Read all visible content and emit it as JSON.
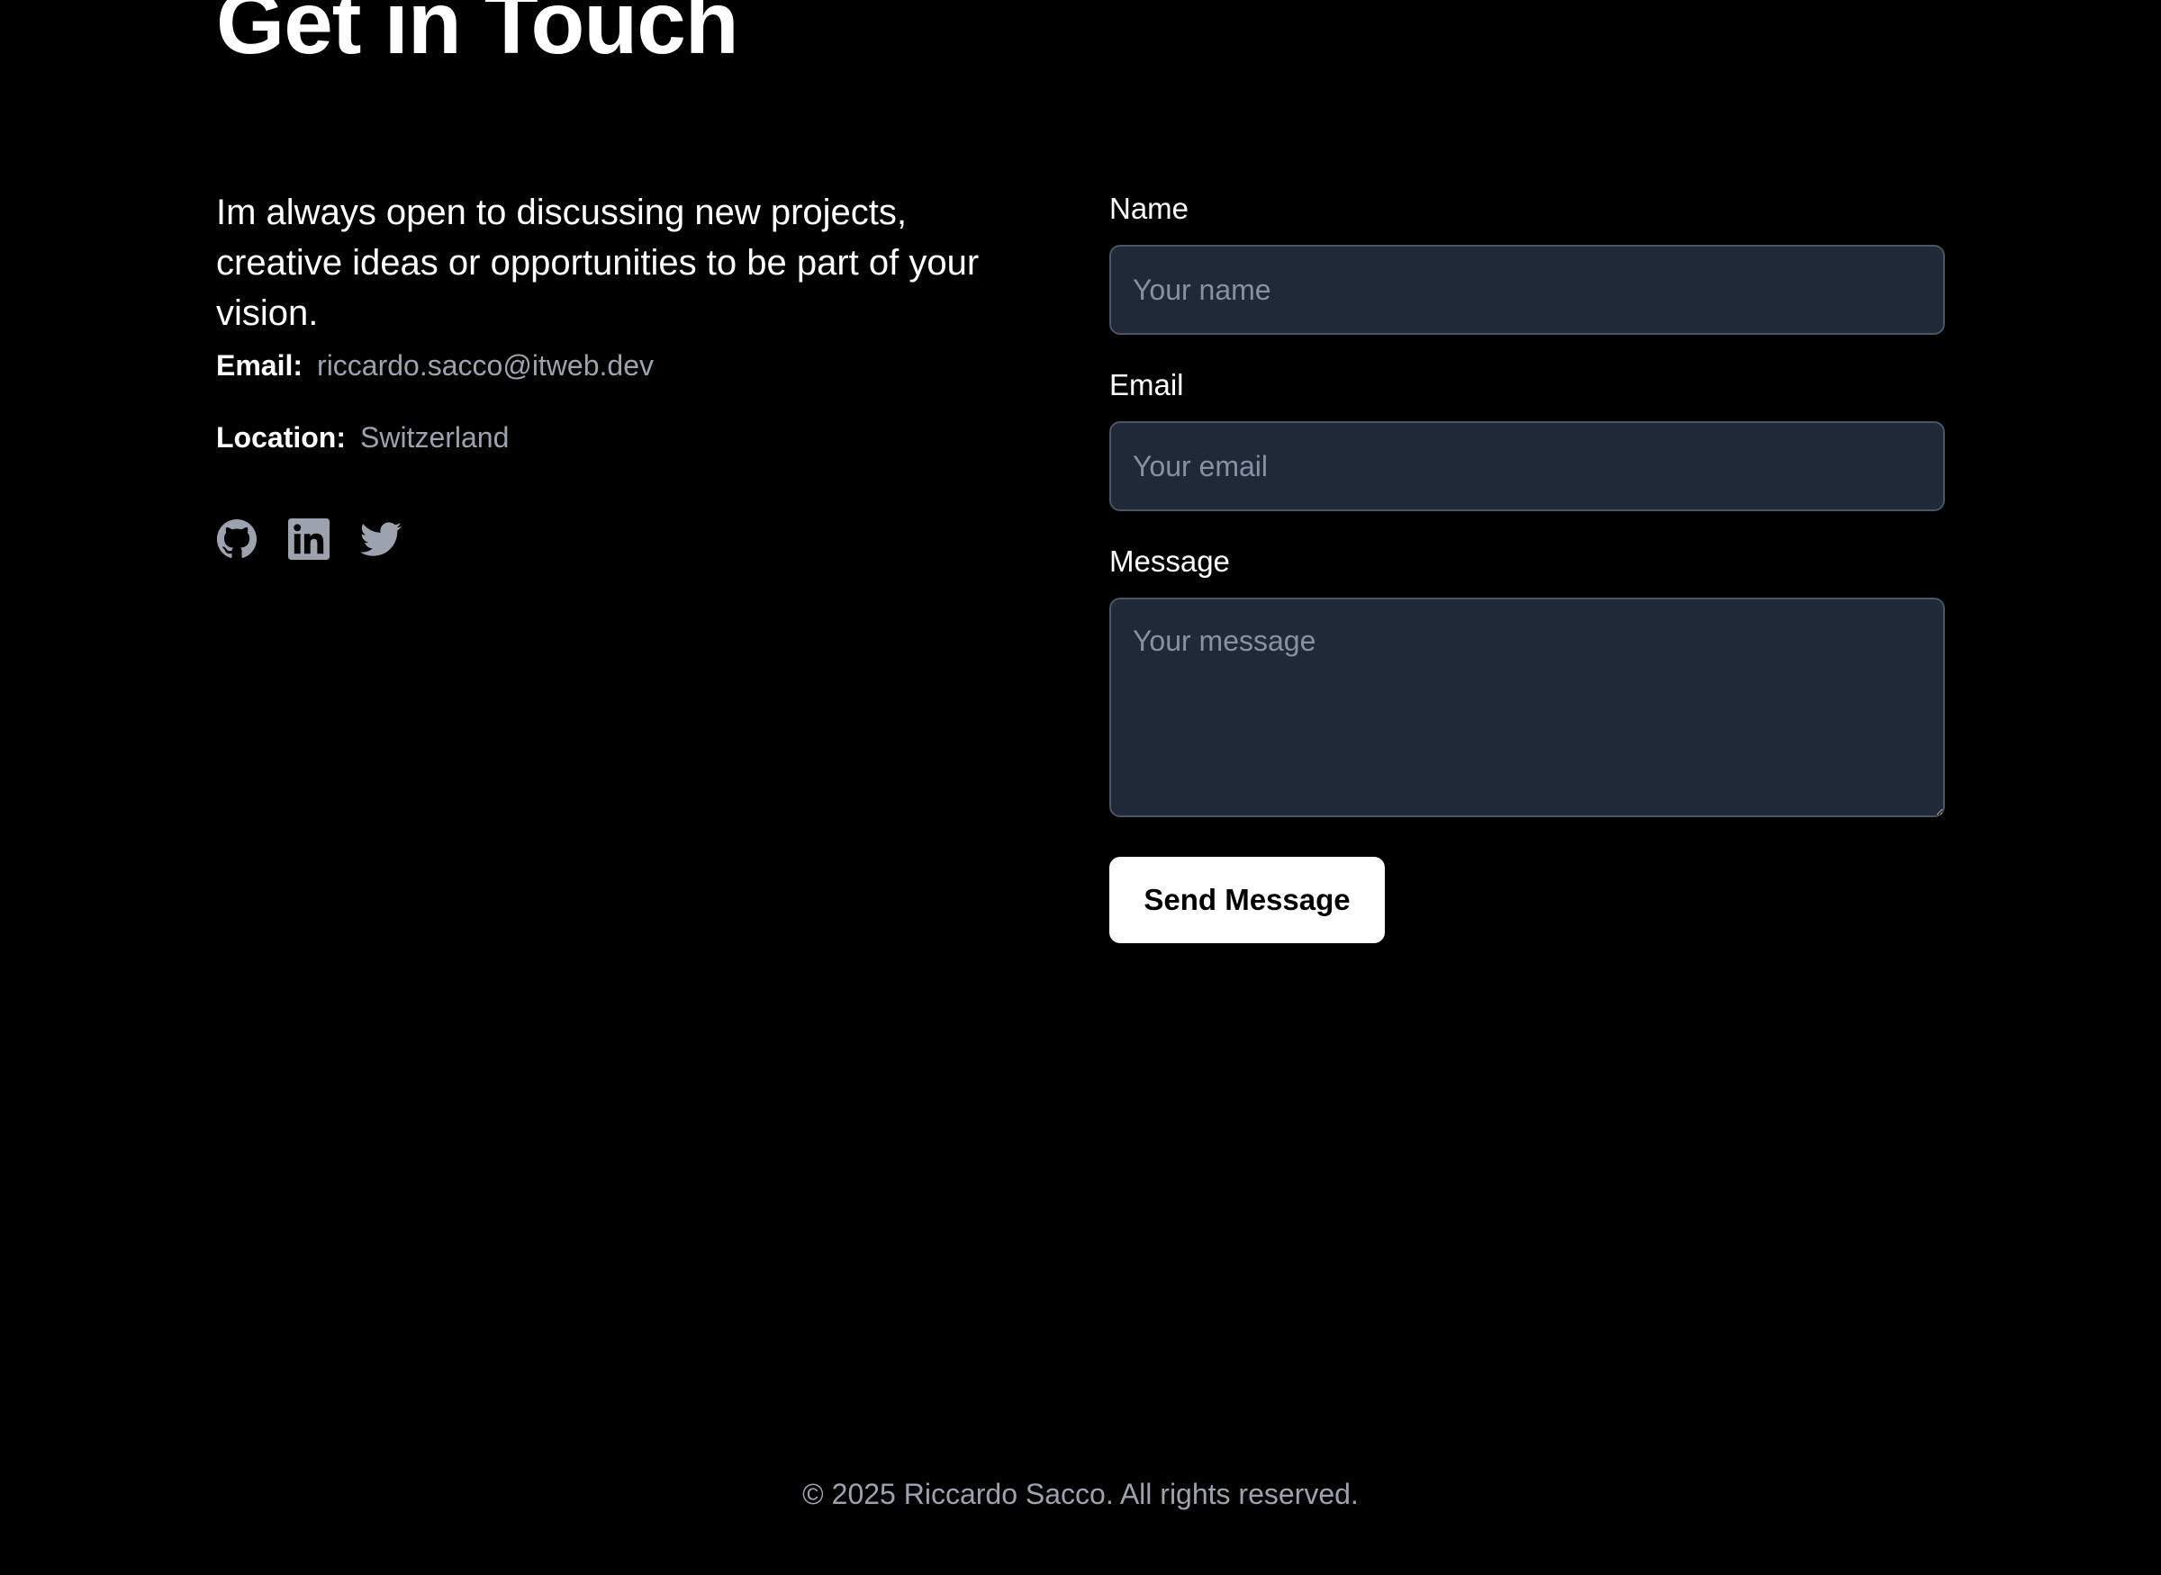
{
  "header": {
    "title": "Get in Touch"
  },
  "contact": {
    "intro": "Im always open to discussing new projects, creative ideas or opportunities to be part of your vision.",
    "email_label": "Email:",
    "email_value": "riccardo.sacco@itweb.dev",
    "location_label": "Location:",
    "location_value": "Switzerland",
    "socials": [
      {
        "name": "github-icon"
      },
      {
        "name": "linkedin-icon"
      },
      {
        "name": "twitter-icon"
      }
    ]
  },
  "form": {
    "name_label": "Name",
    "name_value": "",
    "name_placeholder": "Your name",
    "email_label": "Email",
    "email_value": "",
    "email_placeholder": "Your email",
    "message_label": "Message",
    "message_value": "",
    "message_placeholder": "Your message",
    "submit_label": "Send Message"
  },
  "footer": {
    "copyright": "© 2025 Riccardo Sacco. All rights reserved."
  },
  "colors": {
    "background": "#000000",
    "input_background": "#1f2937",
    "input_border": "#4b5563",
    "muted_text": "#9ca3af",
    "button_background": "#ffffff"
  }
}
